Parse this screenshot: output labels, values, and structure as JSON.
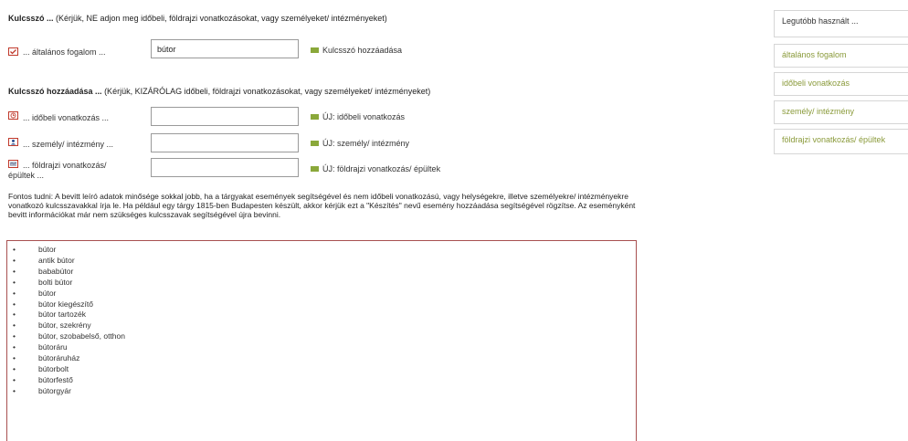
{
  "keyword_section": {
    "title": "Kulcsszó ...",
    "hint": "(Kérjük, NE adjon meg időbeli, földrajzi vonatkozásokat, vagy személyeket/ intézményeket)",
    "general_label": "... általános fogalom ...",
    "general_value": "bútor",
    "add_label": "Kulcsszó hozzáadása"
  },
  "add_section": {
    "title": "Kulcsszó hozzáadása ...",
    "hint": "(Kérjük, KIZÁRÓLAG időbeli, földrajzi vonatkozásokat, vagy személyeket/ intézményeket)",
    "rows": [
      {
        "icon": "clock-icon",
        "label": "... időbeli vonatkozás ...",
        "value": "",
        "new_label": "ÚJ: időbeli vonatkozás"
      },
      {
        "icon": "person-icon",
        "label": "... személy/ intézmény ...",
        "value": "",
        "new_label": "ÚJ: személy/ intézmény"
      },
      {
        "icon": "map-icon",
        "label_line1": "... földrajzi vonatkozás/",
        "label_line2": "épültek ...",
        "value": "",
        "new_label": "ÚJ: földrajzi vonatkozás/ épültek"
      }
    ]
  },
  "note": "Fontos tudni: A bevitt leíró adatok minősége sokkal jobb, ha a tárgyakat események segítségével és nem időbeli vonatkozású, vagy helységekre, illetve személyekre/ intézményekre vonatkozó kulcsszavakkal írja le. Ha például egy tárgy 1815-ben Budapesten készült, akkor kérjük ezt a \"Készítés\" nevű esemény hozzáadása segítségével rögzítse. Az eseményként bevitt információkat már nem szükséges kulcsszavak segítségével újra bevinni.",
  "suggestions": [
    "bútor",
    "antik bútor",
    "bababútor",
    "bolti bútor",
    "bútor",
    "bútor kiegészítő",
    "bútor tartozék",
    "bútor, szekrény",
    "bútor, szobabelső, otthon",
    "bútoráru",
    "bútoráruház",
    "bútorbolt",
    "bútorfestő",
    "bútorgyár"
  ],
  "sidebar": {
    "title": "Legutóbb használt ...",
    "items": [
      "általános fogalom",
      "időbeli vonatkozás",
      "személy/ intézmény",
      "földrajzi vonatkozás/ épültek"
    ]
  },
  "colors": {
    "accent_green": "#8aa83a",
    "icon_red": "#c0392b",
    "sidebar_link": "#8a9a3a"
  }
}
